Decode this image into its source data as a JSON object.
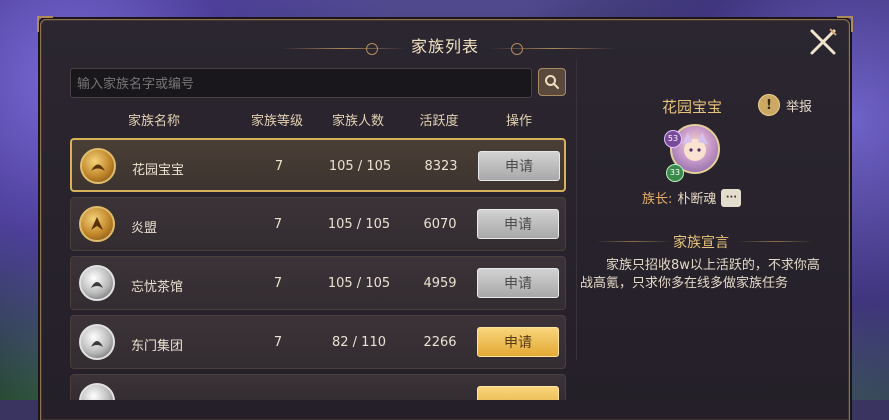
{
  "window": {
    "title": "家族列表"
  },
  "search": {
    "placeholder": "输入家族名字或编号"
  },
  "table": {
    "headers": [
      "家族名称",
      "家族等级",
      "家族人数",
      "活跃度",
      "操作"
    ],
    "rows": [
      {
        "name": "花园宝宝",
        "level": "7",
        "members": "105 / 105",
        "activity": "8323",
        "action": "申请",
        "emblem": "gold",
        "button": "grey",
        "selected": true
      },
      {
        "name": "炎盟",
        "level": "7",
        "members": "105 / 105",
        "activity": "6070",
        "action": "申请",
        "emblem": "gold",
        "button": "grey",
        "selected": false
      },
      {
        "name": "忘忧茶馆",
        "level": "7",
        "members": "105 / 105",
        "activity": "4959",
        "action": "申请",
        "emblem": "silver",
        "button": "grey",
        "selected": false
      },
      {
        "name": "东门集团",
        "level": "7",
        "members": "82 / 110",
        "activity": "2266",
        "action": "申请",
        "emblem": "silver",
        "button": "gold",
        "selected": false
      }
    ]
  },
  "detail": {
    "clan_name": "花园宝宝",
    "report_label": "举报",
    "avatar_levels": [
      "53",
      "33"
    ],
    "leader_label": "族长:",
    "leader_name": "朴断魂",
    "chat_icon": "···",
    "declaration_title": "家族宣言",
    "declaration_text": "家族只招收8w以上活跃的，不求你高战高氪，只求你多在线多做家族任务"
  },
  "icons": {
    "close": "close-icon",
    "search": "search-icon",
    "report": "report-icon",
    "chat": "chat-icon"
  },
  "colors": {
    "accent_gold": "#e8c37a",
    "button_gold": "#e3a934",
    "button_grey": "#a8a8a8"
  }
}
